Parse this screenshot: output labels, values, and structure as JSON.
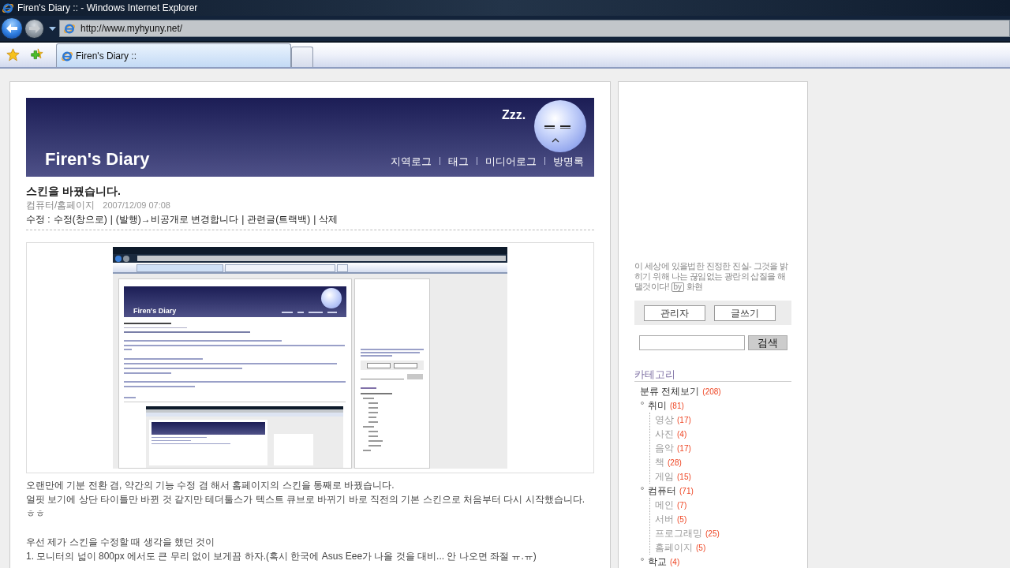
{
  "window": {
    "title": "Firen's Diary :: - Windows Internet Explorer"
  },
  "nav_buttons": [
    {
      "kind": "back",
      "disabled": false
    },
    {
      "kind": "forward",
      "disabled": true
    }
  ],
  "address_bar": {
    "url": "http://www.myhyuny.net/"
  },
  "tabs": [
    {
      "label": "Firen's Diary ::",
      "selected": true
    }
  ],
  "blog": {
    "title": "Firen's Diary",
    "zzz": "Zzz.",
    "menu": [
      "지역로그",
      "태그",
      "미디어로그",
      "방명록"
    ]
  },
  "post": {
    "title": "스킨을 바꿨습니다.",
    "category": "컴퓨터/홈페이지",
    "date": "2007/12/09 07:08",
    "actions": {
      "label": "수정 :",
      "separator": "|",
      "links": [
        "수정(창으로)",
        "(발행)→비공개로 변경합니다",
        "관련글(트랙백)",
        "삭제"
      ]
    },
    "image": {
      "banner_title": "Firen's Diary"
    },
    "paragraphs": [
      [
        "오랜만에 기분 전환 겸, 약간의 기능 수정 겸 해서 홈페이지의 스킨을 통째로 바꿨습니다.",
        "얼핏 보기에 상단 타이틀만 바뀐 것 같지만 테더툴스가 텍스트 큐브로 바뀌기 바로 직전의 기본 스킨으로 처음부터 다시 시작했습니다. ㅎㅎ"
      ],
      [
        "우선 제가 스킨을 수정할 때 생각을 했던 것이",
        "1. 모니터의 넓이 800px 에서도 큰 무리 없이 보게끔 하자.(혹시 한국에 Asus Eee가 나올 것을 대비... 안 나오면 좌절 ㅠ.ㅠ)"
      ]
    ]
  },
  "sidebar": {
    "quote": "이 세상에 있을법한 진정한 진실- 그것을 밝히기 위해 나는 끊임없는 광란의 삽질을 해 댈것이다!",
    "by": "by",
    "author": "화현",
    "buttons": [
      "관리자",
      "글쓰기"
    ],
    "search": {
      "button": "검색"
    },
    "categories": {
      "heading": "카테고리",
      "tree": [
        {
          "label": "분류 전체보기",
          "count": "(208)",
          "children": [
            {
              "label": "취미",
              "count": "(81)",
              "children": [
                {
                  "label": "영상",
                  "count": "(17)"
                },
                {
                  "label": "사진",
                  "count": "(4)"
                },
                {
                  "label": "음악",
                  "count": "(17)"
                },
                {
                  "label": "책",
                  "count": "(28)"
                },
                {
                  "label": "게임",
                  "count": "(15)"
                }
              ]
            },
            {
              "label": "컴퓨터",
              "count": "(71)",
              "children": [
                {
                  "label": "메인",
                  "count": "(7)"
                },
                {
                  "label": "서버",
                  "count": "(5)"
                },
                {
                  "label": "프로그래밍",
                  "count": "(25)"
                },
                {
                  "label": "홈페이지",
                  "count": "(5)"
                }
              ]
            },
            {
              "label": "학교",
              "count": "(4)"
            }
          ]
        }
      ]
    }
  }
}
